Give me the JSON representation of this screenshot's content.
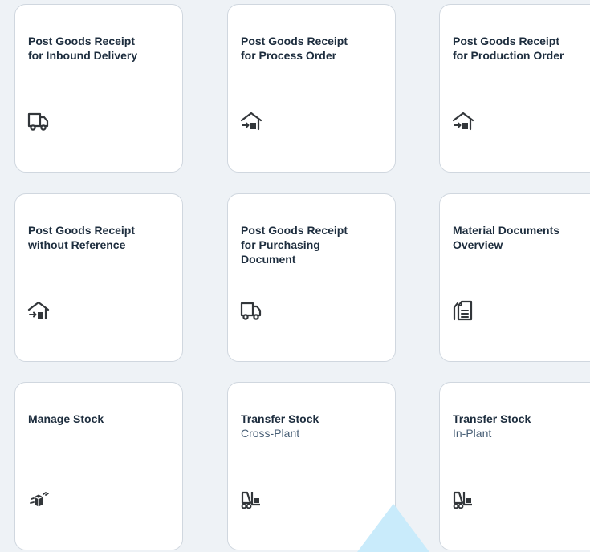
{
  "tiles": [
    {
      "title": "Post Goods Receipt\nfor Inbound Delivery",
      "subtitle": "",
      "icon": "truck-icon"
    },
    {
      "title": "Post Goods Receipt\nfor Process Order",
      "subtitle": "",
      "icon": "warehouse-receipt-icon"
    },
    {
      "title": "Post Goods Receipt\nfor Production Order",
      "subtitle": "",
      "icon": "warehouse-receipt-icon"
    },
    {
      "title": "Post Goods Receipt\nwithout Reference",
      "subtitle": "",
      "icon": "warehouse-receipt-icon"
    },
    {
      "title": "Post Goods Receipt\nfor Purchasing\nDocument",
      "subtitle": "",
      "icon": "truck-icon"
    },
    {
      "title": "Material Documents\nOverview",
      "subtitle": "",
      "icon": "documents-icon"
    },
    {
      "title": "Manage Stock",
      "subtitle": "",
      "icon": "stock-cubes-icon"
    },
    {
      "title": "Transfer Stock",
      "subtitle": "Cross-Plant",
      "icon": "forklift-icon"
    },
    {
      "title": "Transfer Stock",
      "subtitle": "In-Plant",
      "icon": "forklift-icon"
    }
  ],
  "colors": {
    "icon": "#32363a",
    "title": "#1d2d3e",
    "subtitle": "#475e75",
    "background": "#eef2f6",
    "highlight": "#c9ebfb"
  }
}
